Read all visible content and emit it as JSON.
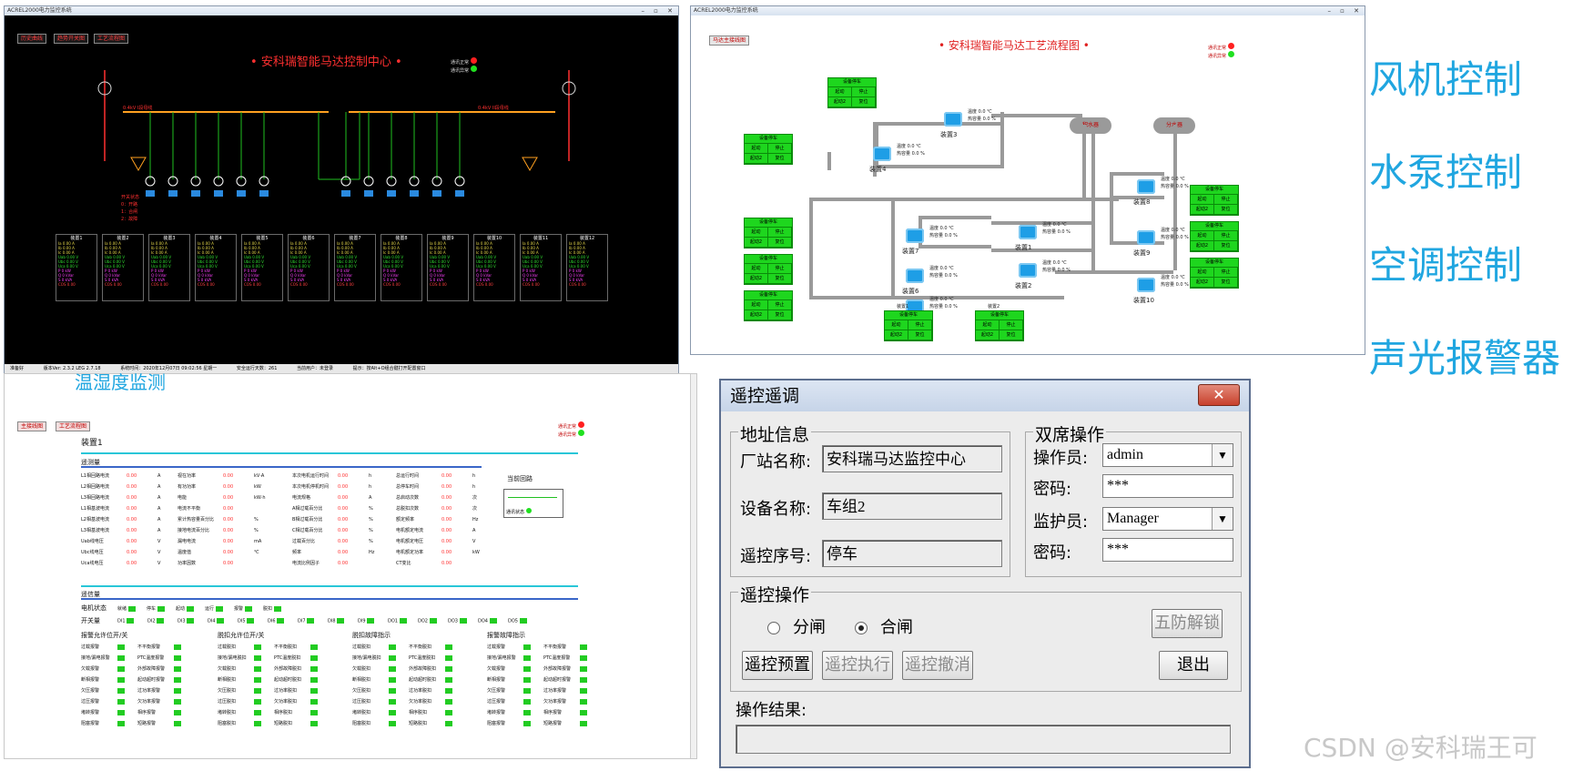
{
  "top_left": {
    "window_title": "ACREL2000电力监控系统",
    "tabs": [
      "历史曲线",
      "趋势开关图",
      "工艺流程图"
    ],
    "title": "安科瑞智能马达控制中心",
    "legend": [
      {
        "label": "通讯正常",
        "color": "#ff2020"
      },
      {
        "label": "通讯异常",
        "color": "#20e020"
      }
    ],
    "bus_left": "0.4kV I段母线",
    "bus_right": "0.4kV II段母线",
    "notes": [
      "开关状态",
      "0：开路",
      "1：合闸",
      "2：故障"
    ],
    "device_labels": [
      "装置1",
      "装置2",
      "装置3",
      "装置4",
      "装置5",
      "装置6",
      "装置7",
      "装置8",
      "装置9",
      "装置10",
      "装置11",
      "装置12"
    ],
    "box_rows": {
      "current": [
        "Ia  0.00  A",
        "Ib  0.00  A",
        "Ic  0.00  A"
      ],
      "voltage": [
        "Uab  0.00  V",
        "Ubc  0.00  V",
        "Uca  0.00  V"
      ],
      "power": [
        "P   0   kW",
        "Q   0   kVar",
        "S   0   kVA",
        "COS  0.00"
      ]
    },
    "status_bar": [
      "准备好",
      "版本Ver: 2.3.2 LEG 2.7.18",
      "系统时间：2020年12月07日 09:02:56  星期一",
      "安全运行天数：261",
      "当前用户：未登录",
      "提示：按Alt+O组合键打开配置窗口"
    ]
  },
  "top_right": {
    "window_title": "ACREL2000电力监控系统",
    "tab": "马达主接线图",
    "title": "安科瑞智能马达工艺流程图",
    "legend": [
      {
        "label": "通讯正常",
        "color": "#ff2020"
      },
      {
        "label": "通讯异常",
        "color": "#20e020"
      }
    ],
    "ctrl_header": "设备停车",
    "ctrl_start": "起动",
    "ctrl_stop": "停止",
    "ctrl_run": "起动2",
    "ctrl_reset": "复位",
    "tank_left": "积水器",
    "tank_right": "分水器",
    "temp_label": "温度",
    "heat_label": "热容量",
    "temp_unit": "℃",
    "heat_unit": "%",
    "val_text": "0.0",
    "devices": [
      "装置1",
      "装置2",
      "装置3",
      "装置4",
      "装置5",
      "装置6",
      "装置7",
      "装置8",
      "装置9",
      "装置10"
    ],
    "bottom_blocks": [
      "装置1",
      "装置2"
    ]
  },
  "side_labels": [
    "风机控制",
    "水泵控制",
    "空调控制",
    "声光报警器"
  ],
  "bottom_left": {
    "overlay_title": "温湿度监测",
    "tabs": [
      "主接线图",
      "工艺流程图"
    ],
    "device_title": "装置1",
    "legend": [
      {
        "label": "通讯正常",
        "color": "#ff2020"
      },
      {
        "label": "通讯异常",
        "color": "#20e020"
      }
    ],
    "sect_measure": "遥测量",
    "sect_signal": "遥信量",
    "current_loop": "当前回路",
    "comm_state": "通讯状态",
    "measure_cols": [
      [
        [
          "L1相回路电流",
          "0.00",
          "A"
        ],
        [
          "L2相回路电流",
          "0.00",
          "A"
        ],
        [
          "L3相回路电流",
          "0.00",
          "A"
        ],
        [
          "L1相基波电流",
          "0.00",
          "A"
        ],
        [
          "L2相基波电流",
          "0.00",
          "A"
        ],
        [
          "L3相基波电流",
          "0.00",
          "A"
        ],
        [
          "Uab线电压",
          "0.00",
          "V"
        ],
        [
          "Ubc线电压",
          "0.00",
          "V"
        ],
        [
          "Uca线电压",
          "0.00",
          "V"
        ]
      ],
      [
        [
          "视在功率",
          "0.00",
          "kV·A"
        ],
        [
          "有功功率",
          "0.00",
          "kW"
        ],
        [
          "电能",
          "0.00",
          "kW·h"
        ],
        [
          "电流不平衡",
          "0.00",
          ""
        ],
        [
          "累计热容量百分比",
          "0.00",
          "%"
        ],
        [
          "接地电流百分比",
          "0.00",
          "%"
        ],
        [
          "漏电电流",
          "0.00",
          "mA"
        ],
        [
          "温度值",
          "0.00",
          "℃"
        ],
        [
          "功率因数",
          "0.00",
          ""
        ]
      ],
      [
        [
          "本次电机运行时间",
          "0.00",
          "h"
        ],
        [
          "本次电机停机时间",
          "0.00",
          "h"
        ],
        [
          "电流规格",
          "0.00",
          "A"
        ],
        [
          "A相过载百分比",
          "0.00",
          "%"
        ],
        [
          "B相过载百分比",
          "0.00",
          "%"
        ],
        [
          "C相过载百分比",
          "0.00",
          "%"
        ],
        [
          "过载百分比",
          "0.00",
          "%"
        ],
        [
          "频率",
          "0.00",
          "Hz"
        ],
        [
          "电流比例因子",
          "0.00",
          ""
        ]
      ],
      [
        [
          "总运行时间",
          "0.00",
          "h"
        ],
        [
          "总停车时间",
          "0.00",
          "h"
        ],
        [
          "总启动次数",
          "0.00",
          "次"
        ],
        [
          "总脱扣次数",
          "0.00",
          "次"
        ],
        [
          "额定频率",
          "0.00",
          "Hz"
        ],
        [
          "电机额定电流",
          "0.00",
          "A"
        ],
        [
          "电机额定电压",
          "0.00",
          "V"
        ],
        [
          "电机额定功率",
          "0.00",
          "kW"
        ],
        [
          "CT变比",
          "0.00",
          ""
        ]
      ]
    ],
    "motor_state_label": "电机状态",
    "motor_states": [
      "就绪",
      "停车",
      "起动",
      "运行",
      "报警",
      "脱扣"
    ],
    "switch_label": "开关量",
    "switches": [
      "DI1",
      "DI2",
      "DI3",
      "DI4",
      "DI5",
      "DI6",
      "DI7",
      "DI8",
      "DI9",
      "DO1",
      "DO2",
      "DO3",
      "DO4",
      "DO5"
    ],
    "groups": [
      {
        "title": "报警允许位开/关",
        "items": [
          "过载报警",
          "接地/漏电报警",
          "欠载报警",
          "断相报警",
          "欠压报警",
          "过压报警",
          "堵转报警",
          "阻塞报警"
        ],
        "items2": [
          "不平衡报警",
          "PTC温度报警",
          "外部故障报警",
          "起动超时报警",
          "过功率报警",
          "欠功率报警",
          "相序报警",
          "短路报警"
        ]
      },
      {
        "title": "脱扣允许位开/关",
        "items": [
          "过载脱扣",
          "接地/漏电脱扣",
          "欠载脱扣",
          "断相脱扣",
          "欠压脱扣",
          "过压脱扣",
          "堵转脱扣",
          "阻塞脱扣"
        ],
        "items2": [
          "不平衡脱扣",
          "PTC温度脱扣",
          "外部故障脱扣",
          "起动超时脱扣",
          "过功率脱扣",
          "欠功率脱扣",
          "相序脱扣",
          "短路脱扣"
        ]
      },
      {
        "title": "脱扣故障指示",
        "items": [
          "过载脱扣",
          "接地/漏电脱扣",
          "欠载脱扣",
          "断相脱扣",
          "欠压脱扣",
          "过压脱扣",
          "堵转脱扣",
          "阻塞脱扣"
        ],
        "items2": [
          "不平衡脱扣",
          "PTC温度脱扣",
          "外部故障脱扣",
          "起动超时脱扣",
          "过功率脱扣",
          "欠功率脱扣",
          "相序脱扣",
          "短路脱扣"
        ]
      },
      {
        "title": "报警故障指示",
        "items": [
          "过载报警",
          "接地/漏电报警",
          "欠载报警",
          "断相报警",
          "欠压报警",
          "过压报警",
          "堵转报警",
          "阻塞报警"
        ],
        "items2": [
          "不平衡报警",
          "PTC温度报警",
          "外部故障报警",
          "起动超时报警",
          "过功率报警",
          "欠功率报警",
          "相序报警",
          "短路报警"
        ]
      }
    ]
  },
  "dialog": {
    "title": "遥控遥调",
    "close": "✕",
    "addr_group": "地址信息",
    "station_label": "厂站名称:",
    "station_value": "安科瑞马达监控中心",
    "device_label": "设备名称:",
    "device_value": "车组2",
    "seq_label": "遥控序号:",
    "seq_value": "停车",
    "dual_group": "双席操作",
    "operator_label": "操作员:",
    "operator_value": "admin",
    "pwd_label": "密码:",
    "pwd_value": "***",
    "monitor_label": "监护员:",
    "monitor_value": "Manager",
    "pwd2_label": "密码:",
    "pwd2_value": "***",
    "op_group": "遥控操作",
    "radio_open": "分闸",
    "radio_close": "合闸",
    "btn_unlock": "五防解锁",
    "btn_preset": "遥控预置",
    "btn_exec": "遥控执行",
    "btn_cancel": "遥控撤消",
    "btn_exit": "退出",
    "result_label": "操作结果:"
  },
  "watermark": "CSDN @安科瑞王可"
}
